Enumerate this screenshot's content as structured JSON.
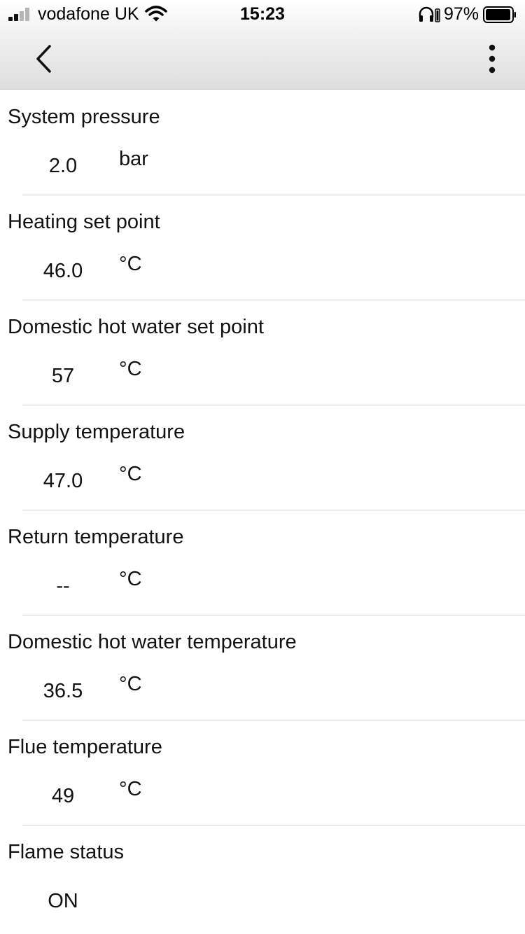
{
  "status_bar": {
    "carrier": "vodafone UK",
    "time": "15:23",
    "battery_percent": "97%",
    "signal_bars_active": 2,
    "signal_bars_total": 4,
    "icons": [
      "signal-icon",
      "wifi-icon",
      "headphones-battery-icon",
      "battery-icon"
    ]
  },
  "nav": {
    "back_icon": "chevron-left-icon",
    "menu_icon": "more-vertical-icon"
  },
  "items": [
    {
      "label": "System pressure",
      "value": "2.0",
      "unit": "bar"
    },
    {
      "label": "Heating set point",
      "value": "46.0",
      "unit": "°C"
    },
    {
      "label": "Domestic hot water set point",
      "value": "57",
      "unit": "°C"
    },
    {
      "label": "Supply temperature",
      "value": "47.0",
      "unit": "°C"
    },
    {
      "label": "Return temperature",
      "value": "--",
      "unit": "°C"
    },
    {
      "label": "Domestic hot water temperature",
      "value": "36.5",
      "unit": "°C"
    },
    {
      "label": "Flue temperature",
      "value": "49",
      "unit": "°C"
    },
    {
      "label": "Flame status",
      "value": "ON",
      "unit": ""
    }
  ],
  "colors": {
    "text": "#111111",
    "divider": "#d3d3d3",
    "signal_inactive": "#b5b5b5"
  }
}
